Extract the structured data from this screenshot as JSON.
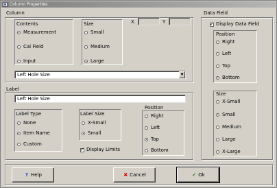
{
  "window": {
    "title": "Column Properties"
  },
  "column": {
    "group_label": "Column",
    "contents": {
      "label": "Contents",
      "options": [
        "Measurement",
        "Cal Field",
        "Input"
      ],
      "selected": 0
    },
    "size": {
      "label": "Size",
      "options": [
        "Small",
        "Medium",
        "Large"
      ],
      "selected": 2
    },
    "x_label": "X",
    "x_value": "",
    "y_label": "Y",
    "y_value": "",
    "field_select": {
      "value": "Left Hole Size"
    }
  },
  "label": {
    "group_label": "Label",
    "text_value": "Left Hole Size",
    "label_type": {
      "label": "Label Type",
      "options": [
        "None",
        "Item Name",
        "Custom"
      ],
      "selected": 1
    },
    "label_size": {
      "label": "Label Size",
      "options": [
        "X-Small",
        "Small"
      ],
      "selected": 1
    },
    "display_limits": {
      "label": "Display Limits",
      "checked": true
    },
    "position": {
      "label": "Position",
      "options": [
        "Right",
        "Left",
        "Top",
        "Bottom"
      ],
      "selected": 2
    }
  },
  "data_field": {
    "group_label": "Data Field",
    "display": {
      "label": "Display Data Field",
      "checked": true
    },
    "position": {
      "label": "Position",
      "options": [
        "Right",
        "Left",
        "Top",
        "Bottom"
      ],
      "selected": 3
    },
    "size": {
      "label": "Size",
      "options": [
        "X-Small",
        "Small",
        "Medium",
        "Large",
        "X-Large"
      ],
      "selected": 1
    }
  },
  "buttons": {
    "help": {
      "label": "Help",
      "icon": "?"
    },
    "cancel": {
      "label": "Cancel",
      "icon": "✖",
      "icon_color": "#cc0000"
    },
    "ok": {
      "label": "Ok",
      "icon": "✔",
      "icon_color": "#1a8a1a"
    }
  }
}
